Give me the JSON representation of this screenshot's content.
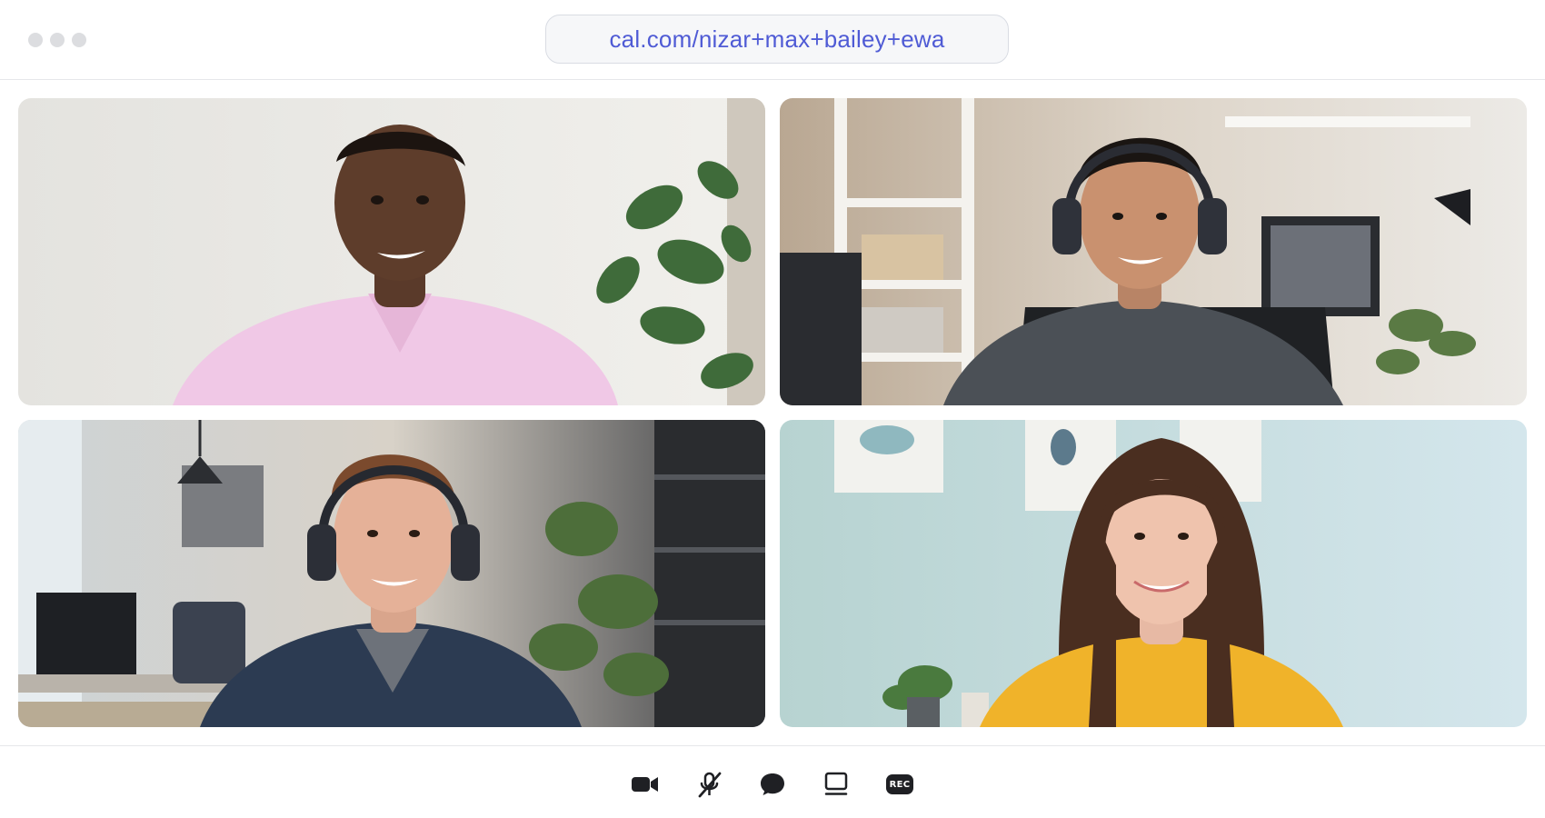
{
  "browser": {
    "url": "cal.com/nizar+max+bailey+ewa"
  },
  "participants": [
    {
      "id": "participant-1",
      "shirt_color": "#f0c8e6",
      "background": "#e9e8e4"
    },
    {
      "id": "participant-2",
      "shirt_color": "#4b5056",
      "background": "#cdbfae"
    },
    {
      "id": "participant-3",
      "shirt_color": "#2c3b52",
      "background": "#cfd3d4"
    },
    {
      "id": "participant-4",
      "shirt_color": "#f0b32a",
      "background": "#bcd6d4"
    }
  ],
  "controls": [
    {
      "name": "camera-icon"
    },
    {
      "name": "microphone-muted-icon"
    },
    {
      "name": "chat-icon"
    },
    {
      "name": "screen-share-icon"
    },
    {
      "name": "record-icon",
      "label": "REC"
    }
  ],
  "colors": {
    "accent": "#4f5bd5",
    "icon": "#1f2024",
    "divider": "#e6e7ea"
  }
}
